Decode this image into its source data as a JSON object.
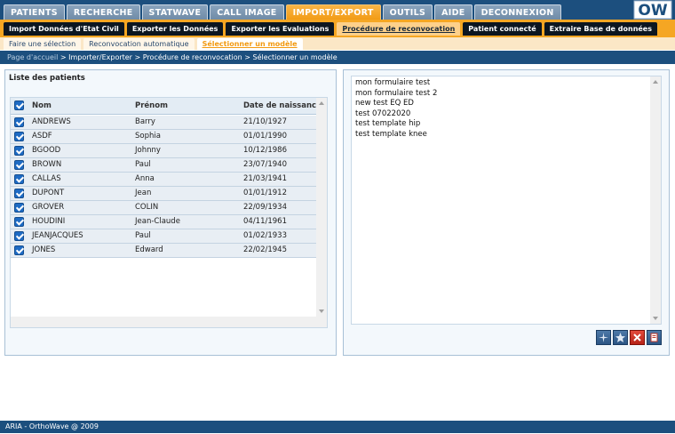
{
  "main_tabs": [
    {
      "label": "PATIENTS",
      "active": false
    },
    {
      "label": "RECHERCHE",
      "active": false
    },
    {
      "label": "STATWAVE",
      "active": false
    },
    {
      "label": "CALL IMAGE",
      "active": false
    },
    {
      "label": "IMPORT/EXPORT",
      "active": true
    },
    {
      "label": "OUTILS",
      "active": false
    },
    {
      "label": "AIDE",
      "active": false
    },
    {
      "label": "DECONNEXION",
      "active": false
    }
  ],
  "logo_text": "OW",
  "sub_tabs": [
    {
      "label": "Import Données d'Etat Civil",
      "active": false
    },
    {
      "label": "Exporter les Données",
      "active": false
    },
    {
      "label": "Exporter les Evaluations",
      "active": false
    },
    {
      "label": "Procédure de reconvocation",
      "active": true
    },
    {
      "label": "Patient connecté",
      "active": false
    },
    {
      "label": "Extraire Base de données",
      "active": false
    }
  ],
  "third_tabs": [
    {
      "label": "Faire une sélection",
      "active": false
    },
    {
      "label": "Reconvocation automatique",
      "active": false
    },
    {
      "label": "Sélectionner un modèle",
      "active": true
    }
  ],
  "breadcrumb": {
    "first": "Page d'accueil",
    "rest": " > Importer/Exporter > Procédure de reconvocation > Sélectionner un modèle"
  },
  "patients": {
    "title": "Liste des patients",
    "columns": {
      "nom": "Nom",
      "prenom": "Prénom",
      "date": "Date de naissance"
    },
    "rows": [
      {
        "nom": "ANDREWS",
        "prenom": "Barry",
        "date": "21/10/1927"
      },
      {
        "nom": "ASDF",
        "prenom": "Sophia",
        "date": "01/01/1990"
      },
      {
        "nom": "BGOOD",
        "prenom": "Johnny",
        "date": "10/12/1986"
      },
      {
        "nom": "BROWN",
        "prenom": "Paul",
        "date": "23/07/1940"
      },
      {
        "nom": "CALLAS",
        "prenom": "Anna",
        "date": "21/03/1941"
      },
      {
        "nom": "DUPONT",
        "prenom": "Jean",
        "date": "01/01/1912"
      },
      {
        "nom": "GROVER",
        "prenom": "COLIN",
        "date": "22/09/1934"
      },
      {
        "nom": "HOUDINI",
        "prenom": "Jean-Claude",
        "date": "04/11/1961"
      },
      {
        "nom": "JEANJACQUES",
        "prenom": "Paul",
        "date": "01/02/1933"
      },
      {
        "nom": "JONES",
        "prenom": "Edward",
        "date": "22/02/1945"
      }
    ]
  },
  "templates": [
    "mon formulaire test",
    "mon formulaire test 2",
    "new test EQ ED",
    "test 07022020",
    "test template hip",
    "test template knee"
  ],
  "footer": "ARIA - OrthoWave @ 2009",
  "colors": {
    "nav_blue": "#1c4f7e",
    "accent_orange": "#f5a623",
    "delete_red": "#c0392b"
  }
}
